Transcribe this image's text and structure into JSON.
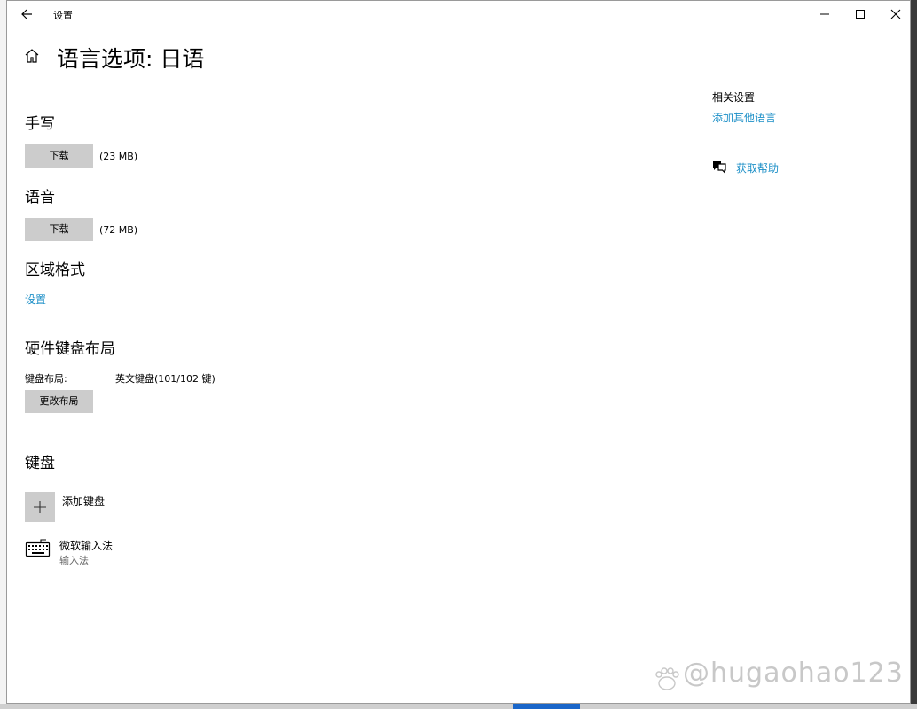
{
  "window": {
    "title": "设置"
  },
  "page": {
    "title": "语言选项: 日语"
  },
  "handwriting": {
    "title": "手写",
    "download_label": "下载",
    "size": "(23 MB)"
  },
  "speech": {
    "title": "语音",
    "download_label": "下载",
    "size": "(72 MB)"
  },
  "regional": {
    "title": "区域格式",
    "settings_link": "设置"
  },
  "hardware_keyboard": {
    "title": "硬件键盘布局",
    "layout_label": "键盘布局:",
    "layout_value": "英文键盘(101/102 键)",
    "change_label": "更改布局"
  },
  "keyboard": {
    "title": "键盘",
    "add_label": "添加键盘",
    "ime_name": "微软输入法",
    "ime_sub": "输入法"
  },
  "related": {
    "title": "相关设置",
    "add_language_link": "添加其他语言",
    "help_link": "获取帮助"
  },
  "watermark": {
    "text": "@hugaohao123"
  },
  "colors": {
    "accent_link": "#1c8fc7",
    "button_bg": "#cccccc"
  }
}
